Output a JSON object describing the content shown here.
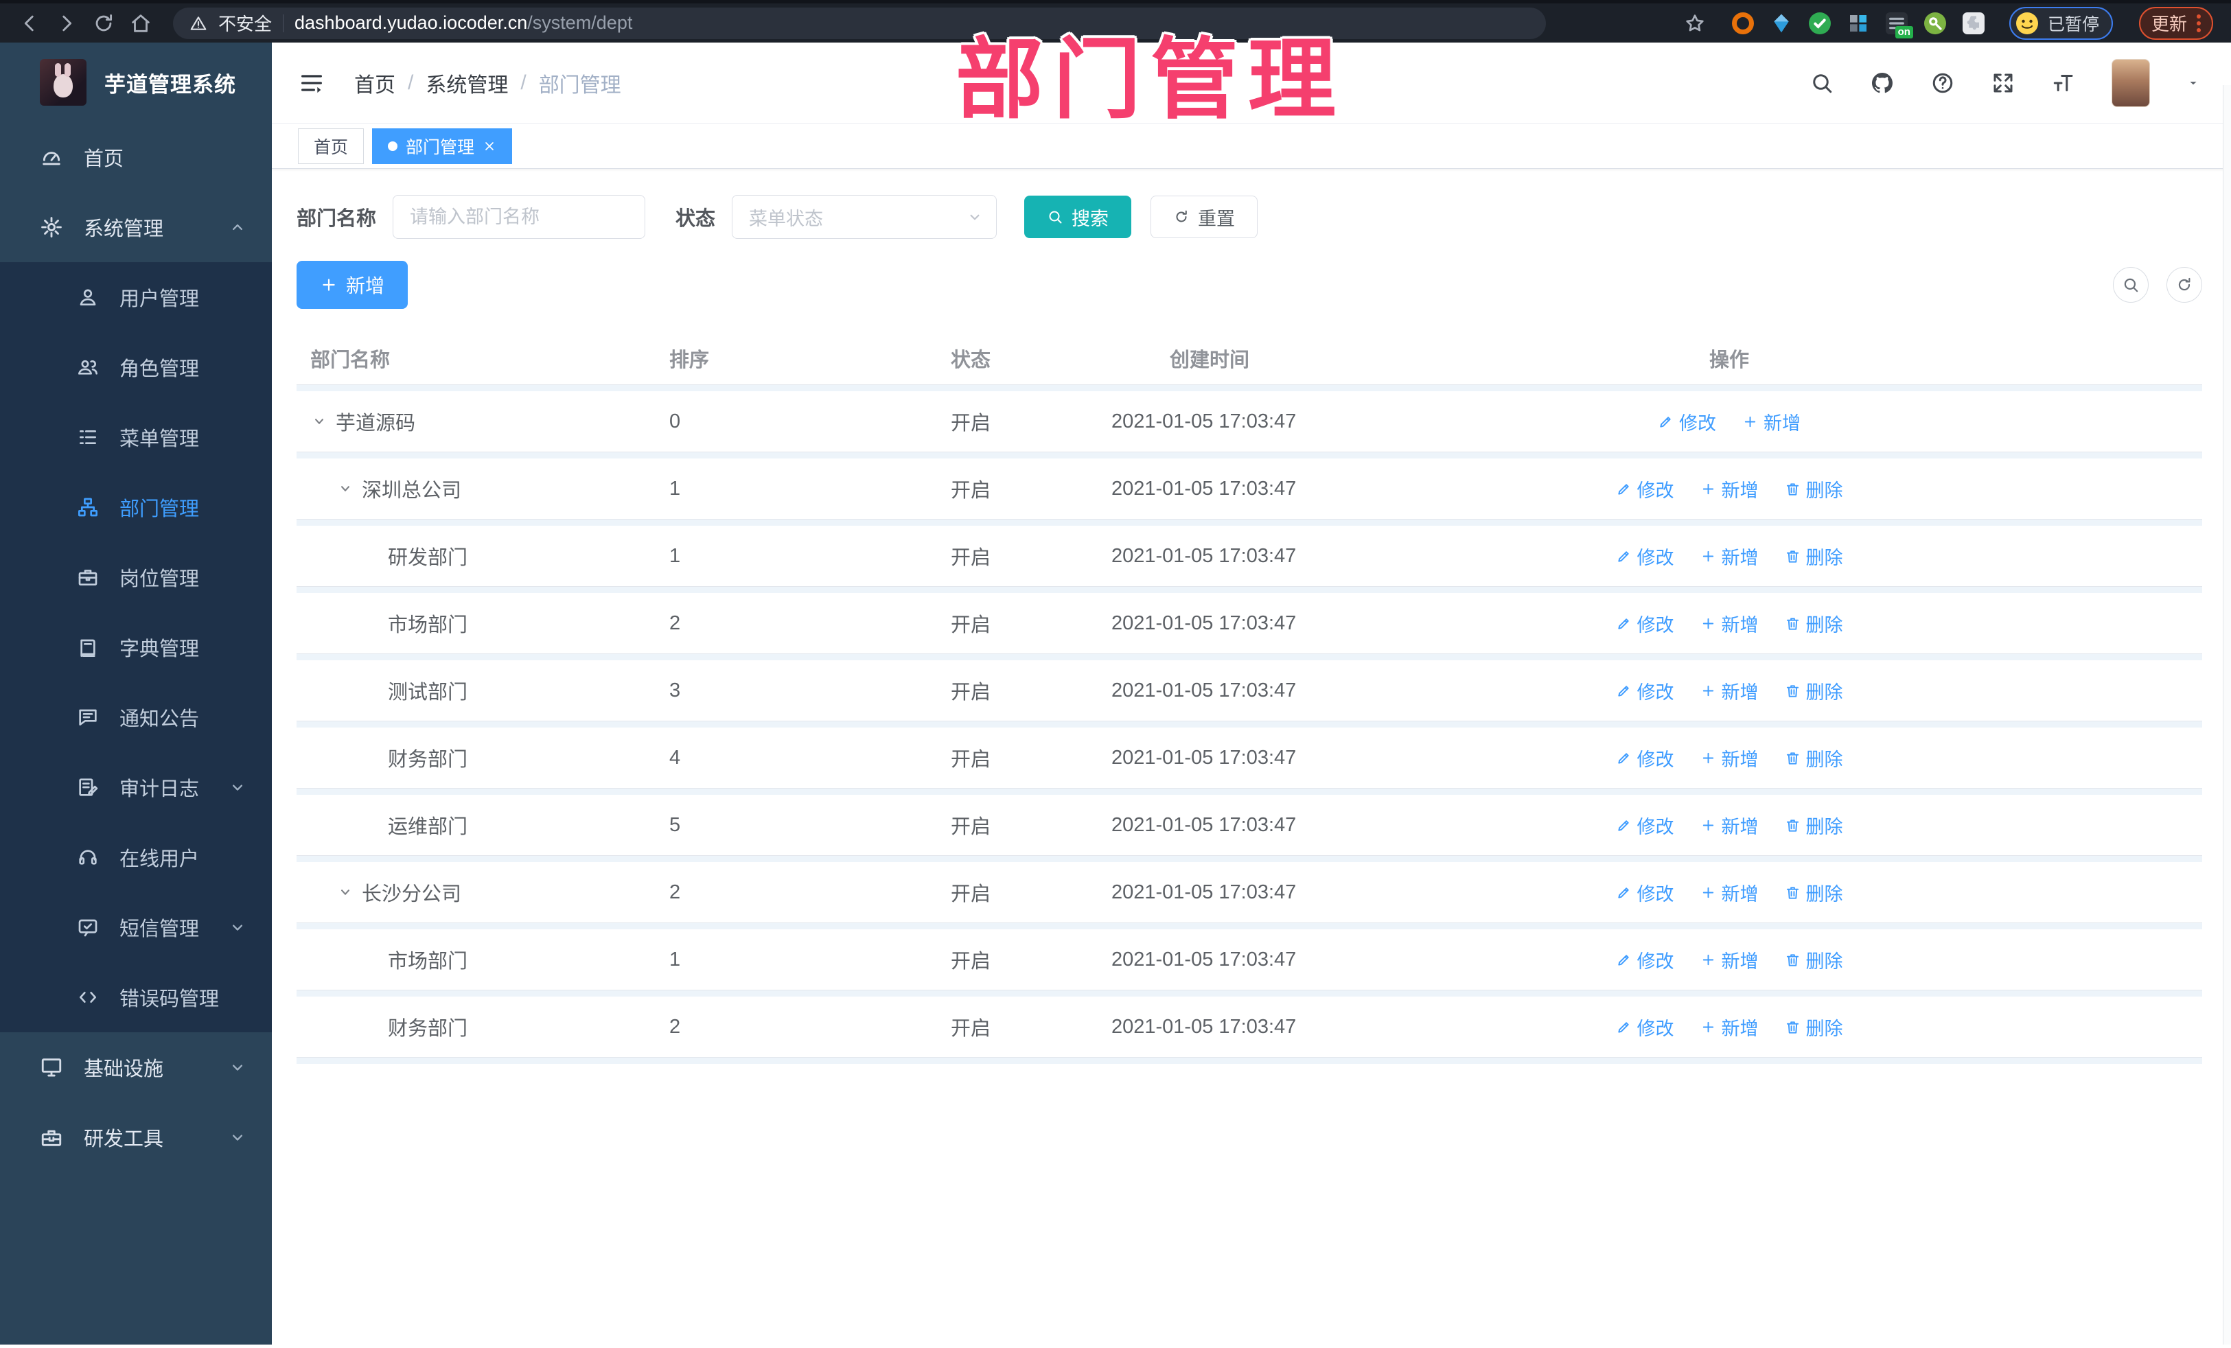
{
  "browser": {
    "security_label": "不安全",
    "url_host": "dashboard.yudao.iocoder.cn",
    "url_path": "/system/dept",
    "profile_status": "已暂停",
    "update_label": "更新",
    "extensions": [
      {
        "id": "orange-ring-extension",
        "color": "#e8710a",
        "style": "ring"
      },
      {
        "id": "blue-gem-extension",
        "color": "#2d9cdb",
        "style": "gem"
      },
      {
        "id": "green-check-extension",
        "color": "#2fab52",
        "style": "check"
      },
      {
        "id": "grid-extension",
        "color": "#5a6472",
        "style": "grid"
      },
      {
        "id": "list-on-extension",
        "color": "#2b3038",
        "style": "list",
        "badge": "on"
      },
      {
        "id": "green-key-extension",
        "color": "#7cb342",
        "style": "key"
      },
      {
        "id": "puzzle-extension",
        "color": "#e8eaed",
        "style": "puzzle"
      }
    ]
  },
  "watermark": {
    "text": "部门管理",
    "color": "#f53f6e"
  },
  "app": {
    "logo_title": "芋道管理系统"
  },
  "sidebar": {
    "items": [
      {
        "id": "home",
        "label": "首页",
        "icon": "gauge-icon",
        "level": 0
      },
      {
        "id": "system",
        "label": "系统管理",
        "icon": "gear-icon",
        "level": 0,
        "chevron": "up"
      },
      {
        "id": "user",
        "label": "用户管理",
        "icon": "user-icon",
        "level": 1
      },
      {
        "id": "role",
        "label": "角色管理",
        "icon": "users-icon",
        "level": 1
      },
      {
        "id": "menu",
        "label": "菜单管理",
        "icon": "menu-tree-icon",
        "level": 1
      },
      {
        "id": "dept",
        "label": "部门管理",
        "icon": "org-tree-icon",
        "level": 1,
        "active": true
      },
      {
        "id": "post",
        "label": "岗位管理",
        "icon": "briefcase-icon",
        "level": 1
      },
      {
        "id": "dict",
        "label": "字典管理",
        "icon": "book-icon",
        "level": 1
      },
      {
        "id": "notice",
        "label": "通知公告",
        "icon": "notice-icon",
        "level": 1
      },
      {
        "id": "audit-log",
        "label": "审计日志",
        "icon": "log-icon",
        "level": 1,
        "chevron": "down"
      },
      {
        "id": "online-user",
        "label": "在线用户",
        "icon": "headset-icon",
        "level": 1
      },
      {
        "id": "sms",
        "label": "短信管理",
        "icon": "sms-icon",
        "level": 1,
        "chevron": "down"
      },
      {
        "id": "error-code",
        "label": "错误码管理",
        "icon": "code-icon",
        "level": 1
      },
      {
        "id": "infra",
        "label": "基础设施",
        "icon": "monitor-icon",
        "level": 0,
        "chevron": "down"
      },
      {
        "id": "dev-tool",
        "label": "研发工具",
        "icon": "toolbox-icon",
        "level": 0,
        "chevron": "down"
      }
    ]
  },
  "header": {
    "breadcrumb": [
      "首页",
      "系统管理",
      "部门管理"
    ],
    "icons": [
      "search-icon",
      "github-icon",
      "help-icon",
      "fullscreen-icon",
      "font-size-icon"
    ]
  },
  "tabs": [
    {
      "label": "首页",
      "active": false,
      "closable": false
    },
    {
      "label": "部门管理",
      "active": true,
      "closable": true
    }
  ],
  "filters": {
    "name_label": "部门名称",
    "name_placeholder": "请输入部门名称",
    "status_label": "状态",
    "status_placeholder": "菜单状态",
    "search_label": "搜索",
    "reset_label": "重置"
  },
  "toolbar": {
    "add_label": "新增"
  },
  "action_labels": {
    "edit": "修改",
    "add": "新增",
    "delete": "删除"
  },
  "table": {
    "columns": [
      "部门名称",
      "排序",
      "状态",
      "创建时间",
      "操作"
    ],
    "rows": [
      {
        "name": "芋道源码",
        "level": 0,
        "expandable": true,
        "sort": "0",
        "status": "开启",
        "created": "2021-01-05 17:03:47",
        "actions": [
          "edit",
          "add"
        ]
      },
      {
        "name": "深圳总公司",
        "level": 1,
        "expandable": true,
        "sort": "1",
        "status": "开启",
        "created": "2021-01-05 17:03:47",
        "actions": [
          "edit",
          "add",
          "delete"
        ]
      },
      {
        "name": "研发部门",
        "level": 2,
        "expandable": false,
        "sort": "1",
        "status": "开启",
        "created": "2021-01-05 17:03:47",
        "actions": [
          "edit",
          "add",
          "delete"
        ]
      },
      {
        "name": "市场部门",
        "level": 2,
        "expandable": false,
        "sort": "2",
        "status": "开启",
        "created": "2021-01-05 17:03:47",
        "actions": [
          "edit",
          "add",
          "delete"
        ]
      },
      {
        "name": "测试部门",
        "level": 2,
        "expandable": false,
        "sort": "3",
        "status": "开启",
        "created": "2021-01-05 17:03:47",
        "actions": [
          "edit",
          "add",
          "delete"
        ]
      },
      {
        "name": "财务部门",
        "level": 2,
        "expandable": false,
        "sort": "4",
        "status": "开启",
        "created": "2021-01-05 17:03:47",
        "actions": [
          "edit",
          "add",
          "delete"
        ]
      },
      {
        "name": "运维部门",
        "level": 2,
        "expandable": false,
        "sort": "5",
        "status": "开启",
        "created": "2021-01-05 17:03:47",
        "actions": [
          "edit",
          "add",
          "delete"
        ]
      },
      {
        "name": "长沙分公司",
        "level": 1,
        "expandable": true,
        "sort": "2",
        "status": "开启",
        "created": "2021-01-05 17:03:47",
        "actions": [
          "edit",
          "add",
          "delete"
        ]
      },
      {
        "name": "市场部门",
        "level": 2,
        "expandable": false,
        "sort": "1",
        "status": "开启",
        "created": "2021-01-05 17:03:47",
        "actions": [
          "edit",
          "add",
          "delete"
        ]
      },
      {
        "name": "财务部门",
        "level": 2,
        "expandable": false,
        "sort": "2",
        "status": "开启",
        "created": "2021-01-05 17:03:47",
        "actions": [
          "edit",
          "add",
          "delete"
        ]
      }
    ]
  },
  "colors": {
    "primary_blue": "#409eff",
    "search_teal": "#16b3b3",
    "link_blue": "#3e9cff",
    "sidebar_bg": "#2b4459",
    "submenu_bg": "#1e3149",
    "watermark_pink": "#f53f6e",
    "browser_bar_bg": "#1c2129"
  }
}
